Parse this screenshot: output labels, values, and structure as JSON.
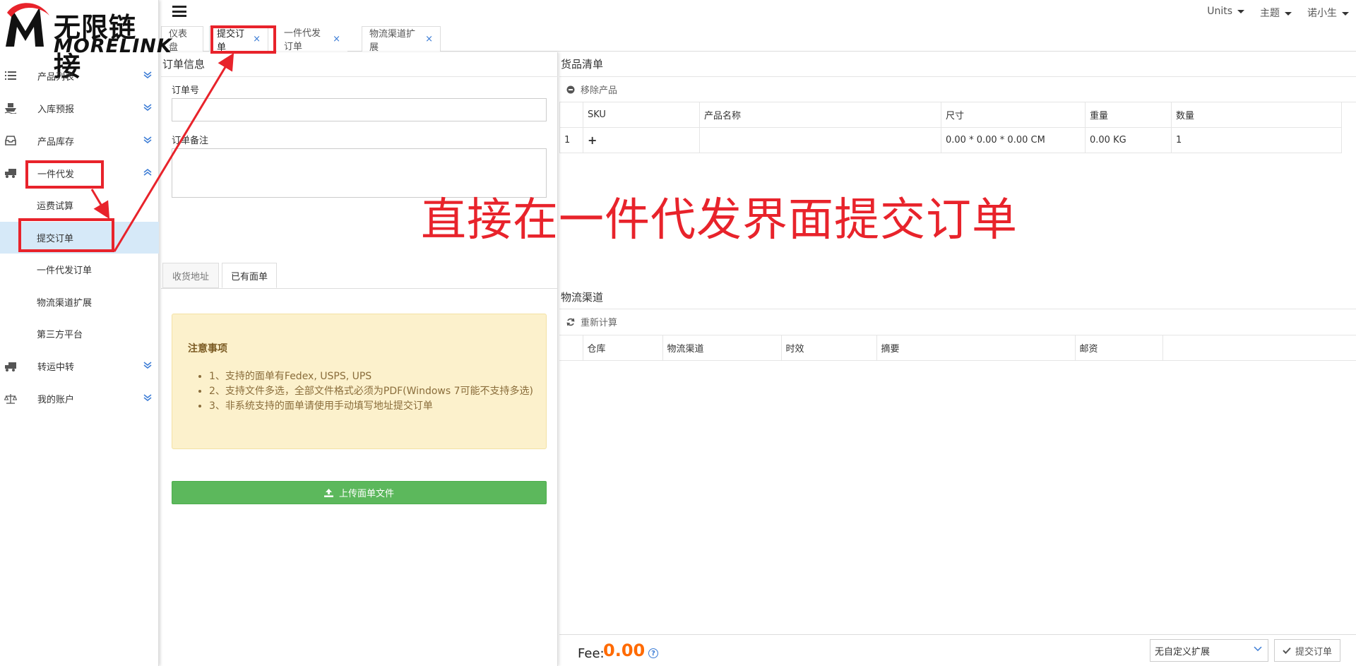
{
  "logo": {
    "cn": "无限链接",
    "en": "MORELINK",
    "mark": "M"
  },
  "sidebar": {
    "items": [
      {
        "label": "产品列表",
        "icon": "list-icon",
        "chev": "double-chevron-down"
      },
      {
        "label": "入库预报",
        "icon": "ship-icon",
        "chev": "double-chevron-down"
      },
      {
        "label": "产品库存",
        "icon": "inbox-icon",
        "chev": "double-chevron-down"
      },
      {
        "label": "一件代发",
        "icon": "truck-icon",
        "chev": "double-chevron-up"
      }
    ],
    "sub_items": [
      {
        "label": "运费试算"
      },
      {
        "label": "提交订单"
      },
      {
        "label": "一件代发订单"
      },
      {
        "label": "物流渠道扩展"
      },
      {
        "label": "第三方平台"
      }
    ],
    "items_after": [
      {
        "label": "转运中转",
        "icon": "truck-icon",
        "chev": "double-chevron-down"
      },
      {
        "label": "我的账户",
        "icon": "balance-scale-icon",
        "chev": "double-chevron-down"
      }
    ]
  },
  "topbar": {
    "units": "Units",
    "theme": "主题",
    "user": "诺小生"
  },
  "tabs": [
    {
      "label": "仪表盘"
    },
    {
      "label": "提交订单",
      "close": "×"
    },
    {
      "label": "一件代发订单",
      "close": "×"
    },
    {
      "label": "物流渠道扩展",
      "close": "×"
    }
  ],
  "order_info": {
    "title": "订单信息",
    "order_no_label": "订单号",
    "order_no_value": "",
    "remark_label": "订单备注",
    "remark_value": "",
    "subtabs": [
      "收货地址",
      "已有面单"
    ],
    "notice_title": "注意事项",
    "notice_items": [
      "1、支持的面单有Fedex, USPS, UPS",
      "2、支持文件多选，全部文件格式必须为PDF(Windows 7可能不支持多选)",
      "3、非系统支持的面单请使用手动填写地址提交订单"
    ],
    "upload_label": "上传面单文件"
  },
  "goods": {
    "title": "货品清单",
    "remove_label": "移除产品",
    "headers": [
      "",
      "SKU",
      "产品名称",
      "尺寸",
      "重量",
      "数量"
    ],
    "rows": [
      {
        "index": "1",
        "sku": "+",
        "name": "",
        "size": "0.00 * 0.00 * 0.00 CM",
        "weight": "0.00 KG",
        "qty": "1"
      }
    ]
  },
  "logistics": {
    "title": "物流渠道",
    "recalc_label": "重新计算",
    "headers": [
      "",
      "仓库",
      "物流渠道",
      "时效",
      "摘要",
      "邮资",
      ""
    ]
  },
  "footer": {
    "fee_label": "Fee:",
    "fee_value": "0.00",
    "help": "?",
    "ext_select": "无自定义扩展",
    "submit_label": "提交订单"
  },
  "annotation": {
    "text": "直接在一件代发界面提交订单",
    "color": "#e8232b"
  }
}
